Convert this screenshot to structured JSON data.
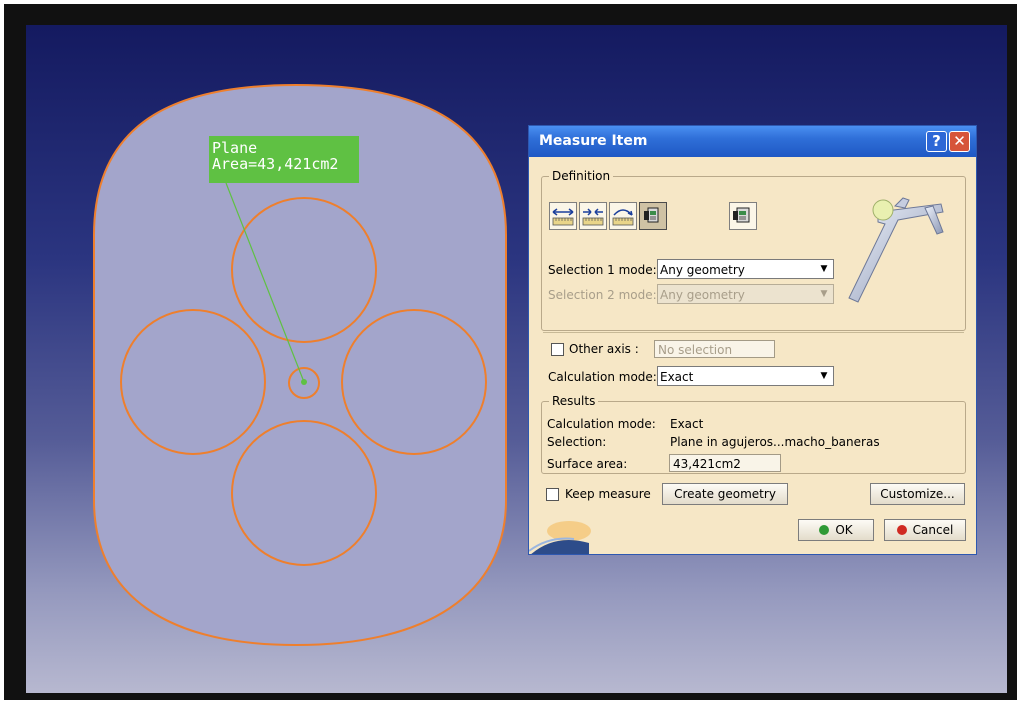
{
  "viewport": {
    "callout": {
      "line1": "Plane",
      "line2": "Area=43,421cm2"
    },
    "colors": {
      "part_fill": "#a3a5cb",
      "edge": "#ee7f2d",
      "callout_bg": "#5fc143"
    }
  },
  "dialog": {
    "title": "Measure Item",
    "help_label": "?",
    "close_label": "✕",
    "definition": {
      "legend": "Definition",
      "tools": [
        "measure-between-icon",
        "measure-item-distance-icon",
        "measure-arc-icon",
        "measure-item-icon",
        "measure-thickness-icon"
      ],
      "selection1_label": "Selection 1 mode:",
      "selection1_value": "Any geometry",
      "selection2_label": "Selection 2 mode:",
      "selection2_value": "Any geometry",
      "other_axis_label": "Other axis :",
      "other_axis_value": "No selection",
      "calc_mode_label": "Calculation mode:",
      "calc_mode_value": "Exact"
    },
    "results": {
      "legend": "Results",
      "calc_mode_label": "Calculation mode:",
      "calc_mode_value": "Exact",
      "selection_label": "Selection:",
      "selection_value": "Plane in agujeros...macho_baneras",
      "surface_area_label": "Surface area:",
      "surface_area_value": "43,421cm2"
    },
    "keep_measure_label": "Keep measure",
    "create_geometry_label": "Create geometry",
    "customize_label": "Customize...",
    "ok_label": "OK",
    "cancel_label": "Cancel"
  }
}
